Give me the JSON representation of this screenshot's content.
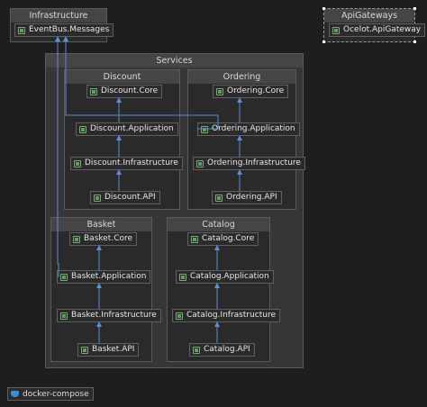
{
  "groups": {
    "infrastructure": {
      "title": "Infrastructure"
    },
    "apigateways": {
      "title": "ApiGateways"
    },
    "services": {
      "title": "Services"
    },
    "discount": {
      "title": "Discount"
    },
    "ordering": {
      "title": "Ordering"
    },
    "basket": {
      "title": "Basket"
    },
    "catalog": {
      "title": "Catalog"
    }
  },
  "nodes": {
    "eventbus_messages": "EventBus.Messages",
    "ocelot_apigateway": "Ocelot.ApiGateway",
    "discount_core": "Discount.Core",
    "discount_application": "Discount.Application",
    "discount_infrastructure": "Discount.Infrastructure",
    "discount_api": "Discount.API",
    "ordering_core": "Ordering.Core",
    "ordering_application": "Ordering.Application",
    "ordering_infrastructure": "Ordering.Infrastructure",
    "ordering_api": "Ordering.API",
    "basket_core": "Basket.Core",
    "basket_application": "Basket.Application",
    "basket_infrastructure": "Basket.Infrastructure",
    "basket_api": "Basket.API",
    "catalog_core": "Catalog.Core",
    "catalog_application": "Catalog.Application",
    "catalog_infrastructure": "Catalog.Infrastructure",
    "catalog_api": "Catalog.API"
  },
  "docker_compose": {
    "label": "docker-compose",
    "icon": "docker-icon"
  },
  "colors": {
    "background": "#1e1e1e",
    "group_header": "#454545",
    "node_border": "#5f5f5f",
    "edge": "#5b8fd6",
    "project_icon": "#5fa05f"
  }
}
